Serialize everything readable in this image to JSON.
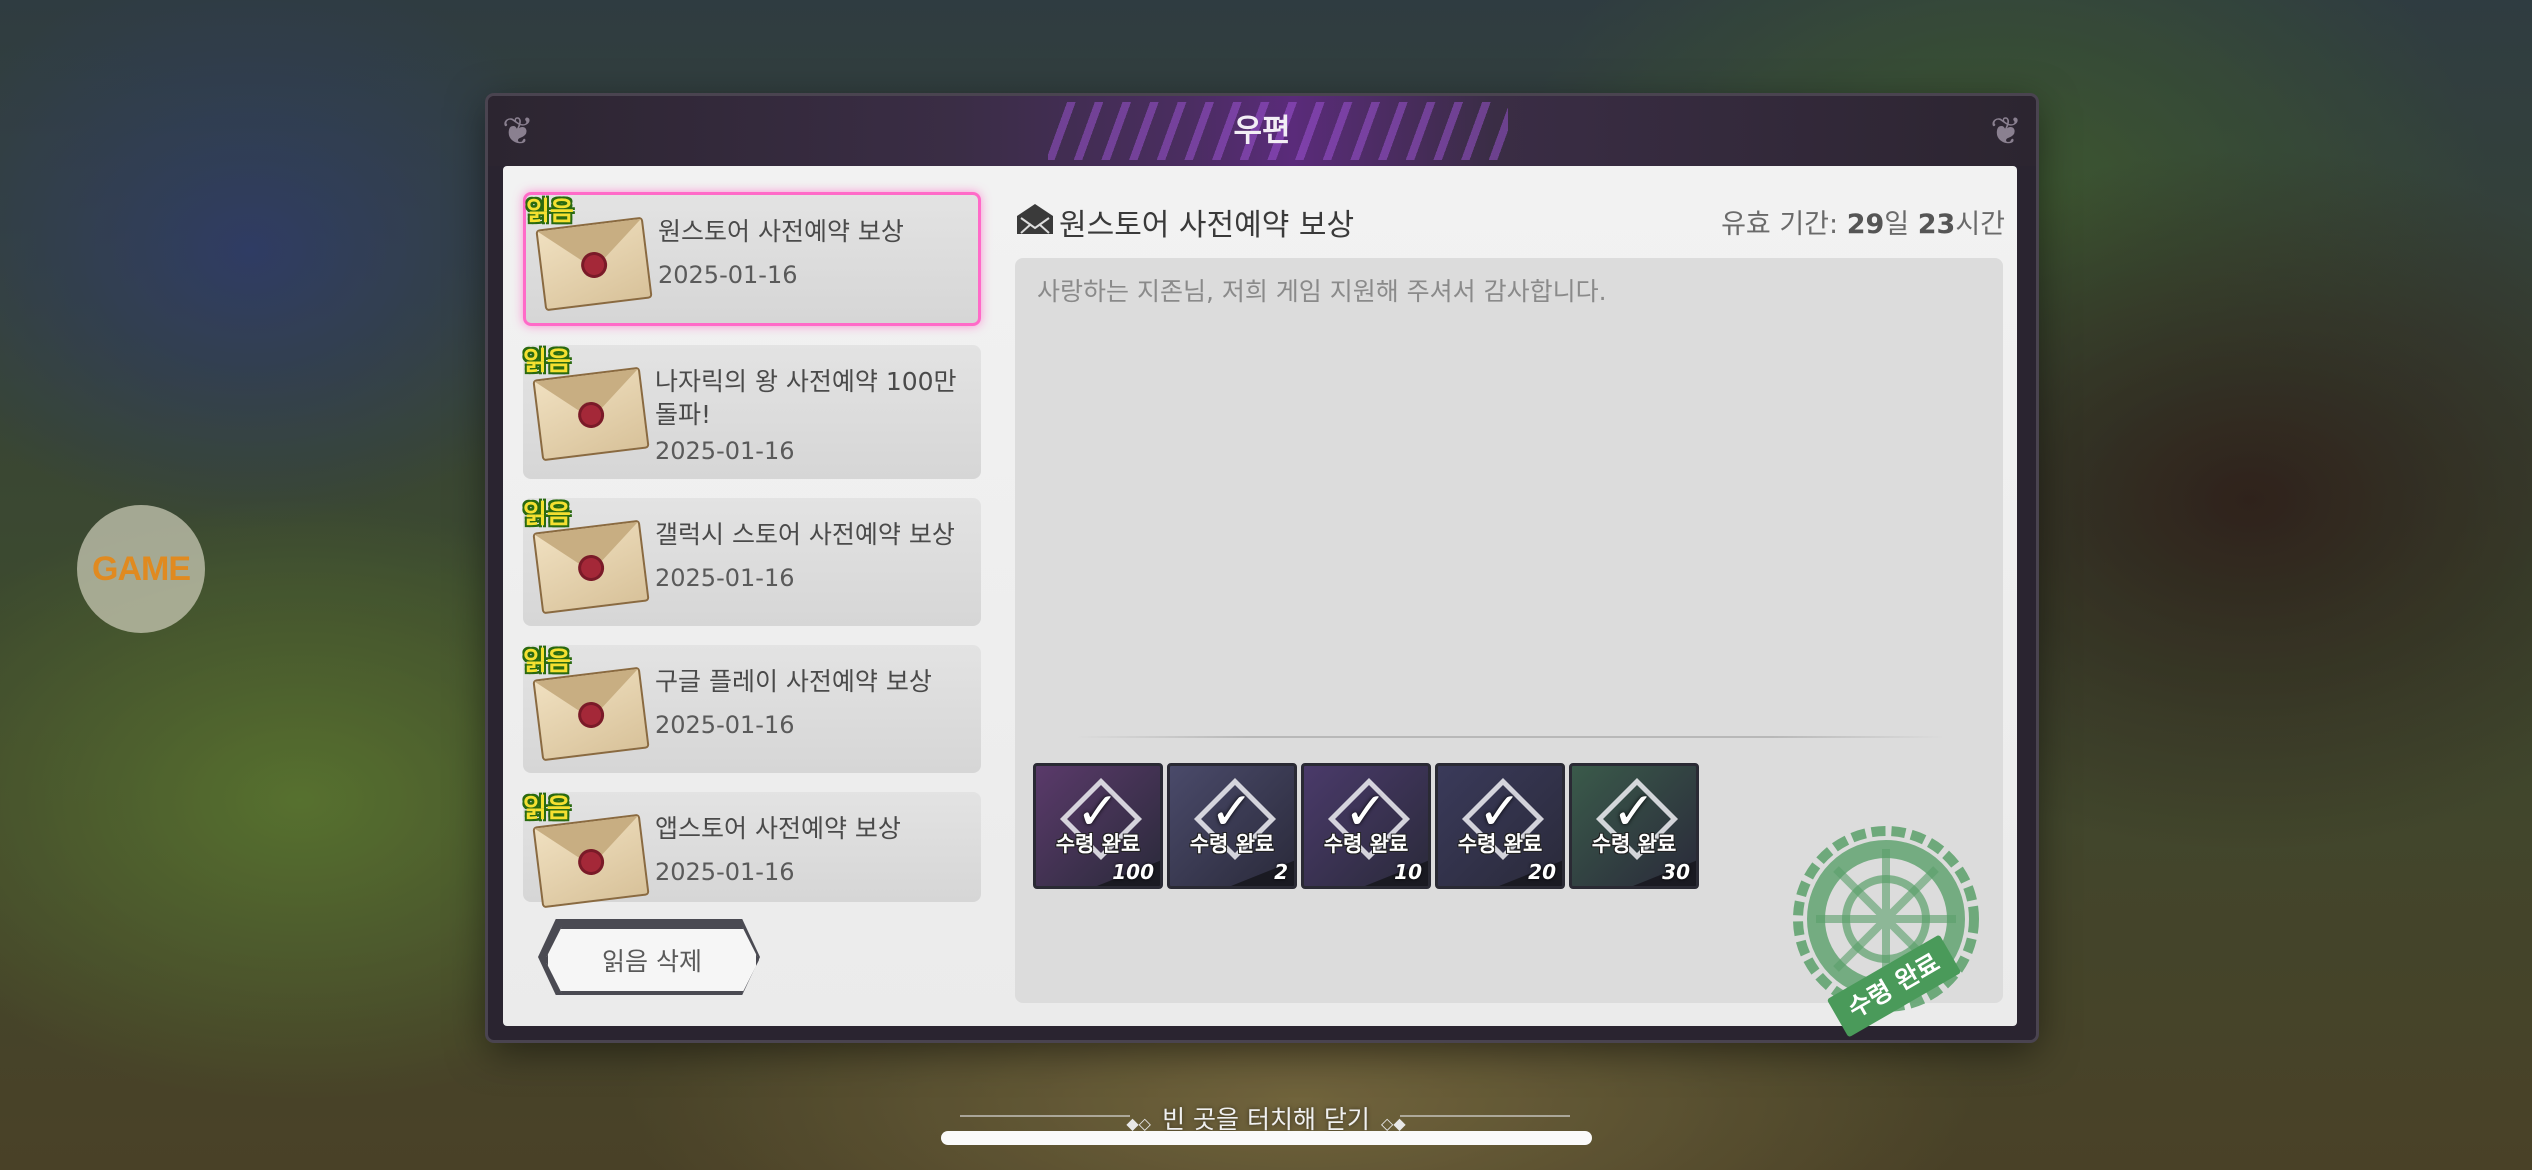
{
  "side_button": {
    "label": "GAME"
  },
  "modal": {
    "title": "우편",
    "read_badge": "읽음",
    "mails": [
      {
        "title": "원스토어 사전예약 보상",
        "date": "2025-01-16",
        "selected": true
      },
      {
        "title": "나자릭의 왕 사전예약 100만 돌파!",
        "date": "2025-01-16",
        "selected": false
      },
      {
        "title": "갤럭시 스토어 사전예약 보상",
        "date": "2025-01-16",
        "selected": false
      },
      {
        "title": "구글 플레이 사전예약 보상",
        "date": "2025-01-16",
        "selected": false
      },
      {
        "title": "앱스토어 사전예약 보상",
        "date": "2025-01-16",
        "selected": false
      }
    ],
    "delete_read_label": "읽음 삭제",
    "detail": {
      "title": "원스토어 사전예약 보상",
      "validity_label": "유효 기간:",
      "validity_days": "29",
      "validity_days_unit": "일",
      "validity_hours": "23",
      "validity_hours_unit": "시간",
      "message": "사랑하는 지존님, 저희 게임 지원해 주셔서 감사합니다.",
      "rewards": [
        {
          "status": "수령 완료",
          "qty": "100",
          "color": "#5a3a6a"
        },
        {
          "status": "수령 완료",
          "qty": "2",
          "color": "#4a4a6a"
        },
        {
          "status": "수령 완료",
          "qty": "10",
          "color": "#4a3a6a"
        },
        {
          "status": "수령 완료",
          "qty": "20",
          "color": "#3a3a5a"
        },
        {
          "status": "수령 완료",
          "qty": "30",
          "color": "#3a5a4a"
        }
      ],
      "stamp_label": "수령 완료"
    }
  },
  "close_hint": "빈 곳을 터치해 닫기"
}
